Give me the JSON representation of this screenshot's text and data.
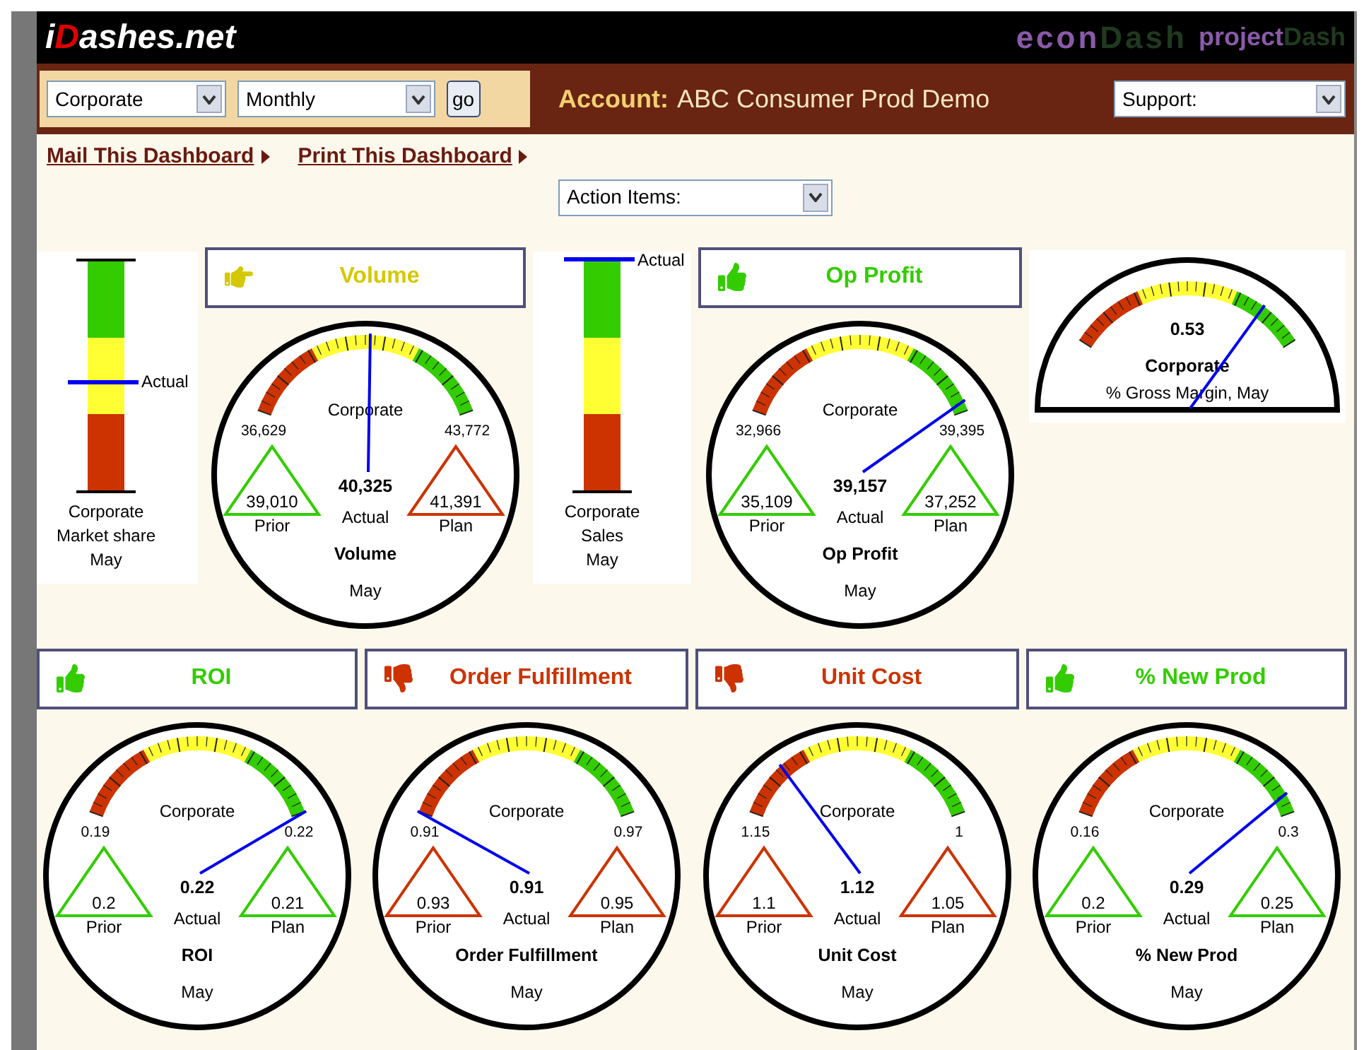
{
  "header": {
    "logo": [
      {
        "text": "i",
        "accent": false
      },
      {
        "text": "D",
        "accent": true
      },
      {
        "text": "ashes.net",
        "accent": false
      }
    ],
    "products": [
      {
        "parts": [
          {
            "text": "econ",
            "accent": false
          },
          {
            "text": "Dash",
            "accent": true
          }
        ]
      },
      {
        "parts": [
          {
            "text": "project",
            "accent": false
          },
          {
            "text": "Dash",
            "accent": true
          }
        ]
      }
    ]
  },
  "toolbar": {
    "scope": "Corporate",
    "period": "Monthly",
    "go": "go",
    "account_label": "Account:",
    "account": "ABC Consumer Prod Demo",
    "support": "Support:"
  },
  "links": [
    "Mail This Dashboard",
    "Print This Dashboard"
  ],
  "action_items": "Action Items:",
  "rows": [
    [
      {
        "kind": "thermometer",
        "level": 0.47,
        "actual_label": "Actual",
        "caption": [
          "Corporate",
          "Market share",
          "May"
        ]
      },
      {
        "kind": "gauge",
        "header": {
          "kind": "pointing",
          "title": "Volume",
          "color": "#d4c800"
        },
        "scope": "Corporate",
        "min": "36,629",
        "max": "43,772",
        "actual": "40,325",
        "actual_label": "Actual",
        "prior": {
          "value": "39,010",
          "label": "Prior",
          "color": "#33cc00"
        },
        "plan": {
          "value": "41,391",
          "label": "Plan",
          "color": "#cc3300"
        },
        "name": "Volume",
        "month": "May"
      },
      {
        "kind": "thermometer",
        "level": 1,
        "actual_label": "Actual",
        "caption": [
          "Corporate",
          "Sales",
          "May"
        ]
      },
      {
        "kind": "gauge",
        "header": {
          "kind": "thumbs_up",
          "title": "Op Profit",
          "color": "#33cc00"
        },
        "scope": "Corporate",
        "min": "32,966",
        "max": "39,395",
        "actual": "39,157",
        "actual_label": "Actual",
        "prior": {
          "value": "35,109",
          "label": "Prior",
          "color": "#33cc00"
        },
        "plan": {
          "value": "37,252",
          "label": "Plan",
          "color": "#33cc00"
        },
        "name": "Op Profit",
        "month": "May"
      },
      {
        "kind": "half_gauge",
        "value": "0.53",
        "scope": "Corporate",
        "subtitle": "% Gross Margin, May"
      }
    ],
    [
      {
        "kind": "gauge",
        "header": {
          "kind": "thumbs_up",
          "title": "ROI",
          "color": "#33cc00"
        },
        "scope": "Corporate",
        "min": "0.19",
        "max": "0.22",
        "actual": "0.22",
        "actual_label": "Actual",
        "prior": {
          "value": "0.2",
          "label": "Prior",
          "color": "#33cc00"
        },
        "plan": {
          "value": "0.21",
          "label": "Plan",
          "color": "#33cc00"
        },
        "name": "ROI",
        "month": "May"
      },
      {
        "kind": "gauge",
        "header": {
          "kind": "thumbs_down",
          "title": "Order Fulfillment",
          "color": "#cc3300"
        },
        "scope": "Corporate",
        "min": "0.91",
        "max": "0.97",
        "actual": "0.91",
        "actual_label": "Actual",
        "prior": {
          "value": "0.93",
          "label": "Prior",
          "color": "#cc3300"
        },
        "plan": {
          "value": "0.95",
          "label": "Plan",
          "color": "#cc3300"
        },
        "name": "Order Fulfillment",
        "month": "May"
      },
      {
        "kind": "gauge",
        "header": {
          "kind": "thumbs_down",
          "title": "Unit Cost",
          "color": "#cc3300"
        },
        "scope": "Corporate",
        "min": "1.15",
        "max": "1",
        "actual": "1.12",
        "actual_label": "Actual",
        "prior": {
          "value": "1.1",
          "label": "Prior",
          "color": "#cc3300"
        },
        "plan": {
          "value": "1.05",
          "label": "Plan",
          "color": "#cc3300"
        },
        "name": "Unit Cost",
        "month": "May"
      },
      {
        "kind": "gauge",
        "header": {
          "kind": "thumbs_up",
          "title": "% New Prod",
          "color": "#33cc00"
        },
        "scope": "Corporate",
        "min": "0.16",
        "max": "0.3",
        "actual": "0.29",
        "actual_label": "Actual",
        "prior": {
          "value": "0.2",
          "label": "Prior",
          "color": "#33cc00"
        },
        "plan": {
          "value": "0.25",
          "label": "Plan",
          "color": "#33cc00"
        },
        "name": "% New Prod",
        "month": "May"
      }
    ]
  ]
}
